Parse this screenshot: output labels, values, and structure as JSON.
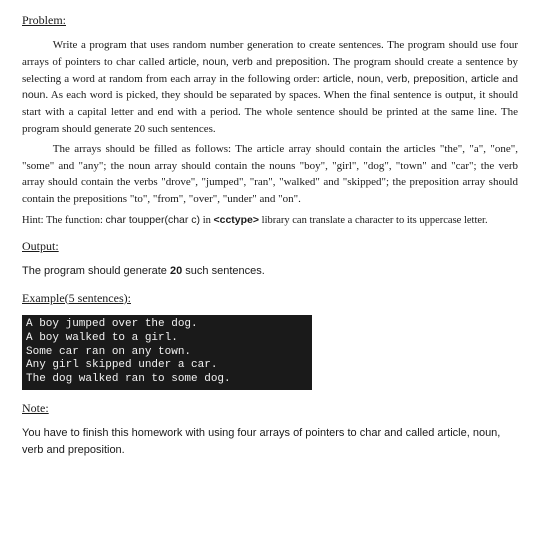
{
  "headings": {
    "problem": "Problem:",
    "output": "Output:",
    "example": "Example(5 sentences):",
    "note": "Note:"
  },
  "problem": {
    "p1_a": "Write a program that uses random number generation to create sentences. The program should use four arrays of pointers to char called ",
    "kw_article": "article",
    "p1_b": ", ",
    "kw_noun": "noun",
    "p1_c": ", ",
    "kw_verb": "verb",
    "p1_d": " and ",
    "kw_prep": "preposition",
    "p1_e": ". The program should create a sentence by selecting a word at random from each array in the following order: ",
    "order": "article, noun, verb, preposition, article",
    "p1_f": " and ",
    "order_last": "noun",
    "p1_g": ". As each word is picked, they should be separated by spaces. When the final sentence is output, it should start with a capital letter and end with a period. The whole sentence should be printed at the same line. The program should generate 20 such sentences.",
    "p2": "The arrays should be filled as follows: The article array should contain the articles \"the\", \"a\", \"one\", \"some\" and \"any\"; the noun array should contain the nouns \"boy\", \"girl\", \"dog\", \"town\" and \"car\"; the verb array should contain the verbs \"drove\", \"jumped\", \"ran\", \"walked\" and \"skipped\"; the preposition array should contain the prepositions \"to\", \"from\", \"over\", \"under\" and \"on\"."
  },
  "hint": {
    "a": "Hint: The function: ",
    "fn": "char toupper(char c)",
    "b": " in ",
    "lib": "<cctype>",
    "c": " library can translate a character to its uppercase letter."
  },
  "output": {
    "a": "The program should generate ",
    "num": "20",
    "b": " such sentences."
  },
  "console": {
    "l1": "A boy jumped over the dog.",
    "l2": "A boy walked to a girl.",
    "l3": "Some car ran on any town.",
    "l4": "Any girl skipped under a car.",
    "l5": "The dog walked ran to some dog."
  },
  "note": {
    "text": "You have to finish this homework with using four arrays of pointers to char and called article, noun, verb and preposition."
  }
}
